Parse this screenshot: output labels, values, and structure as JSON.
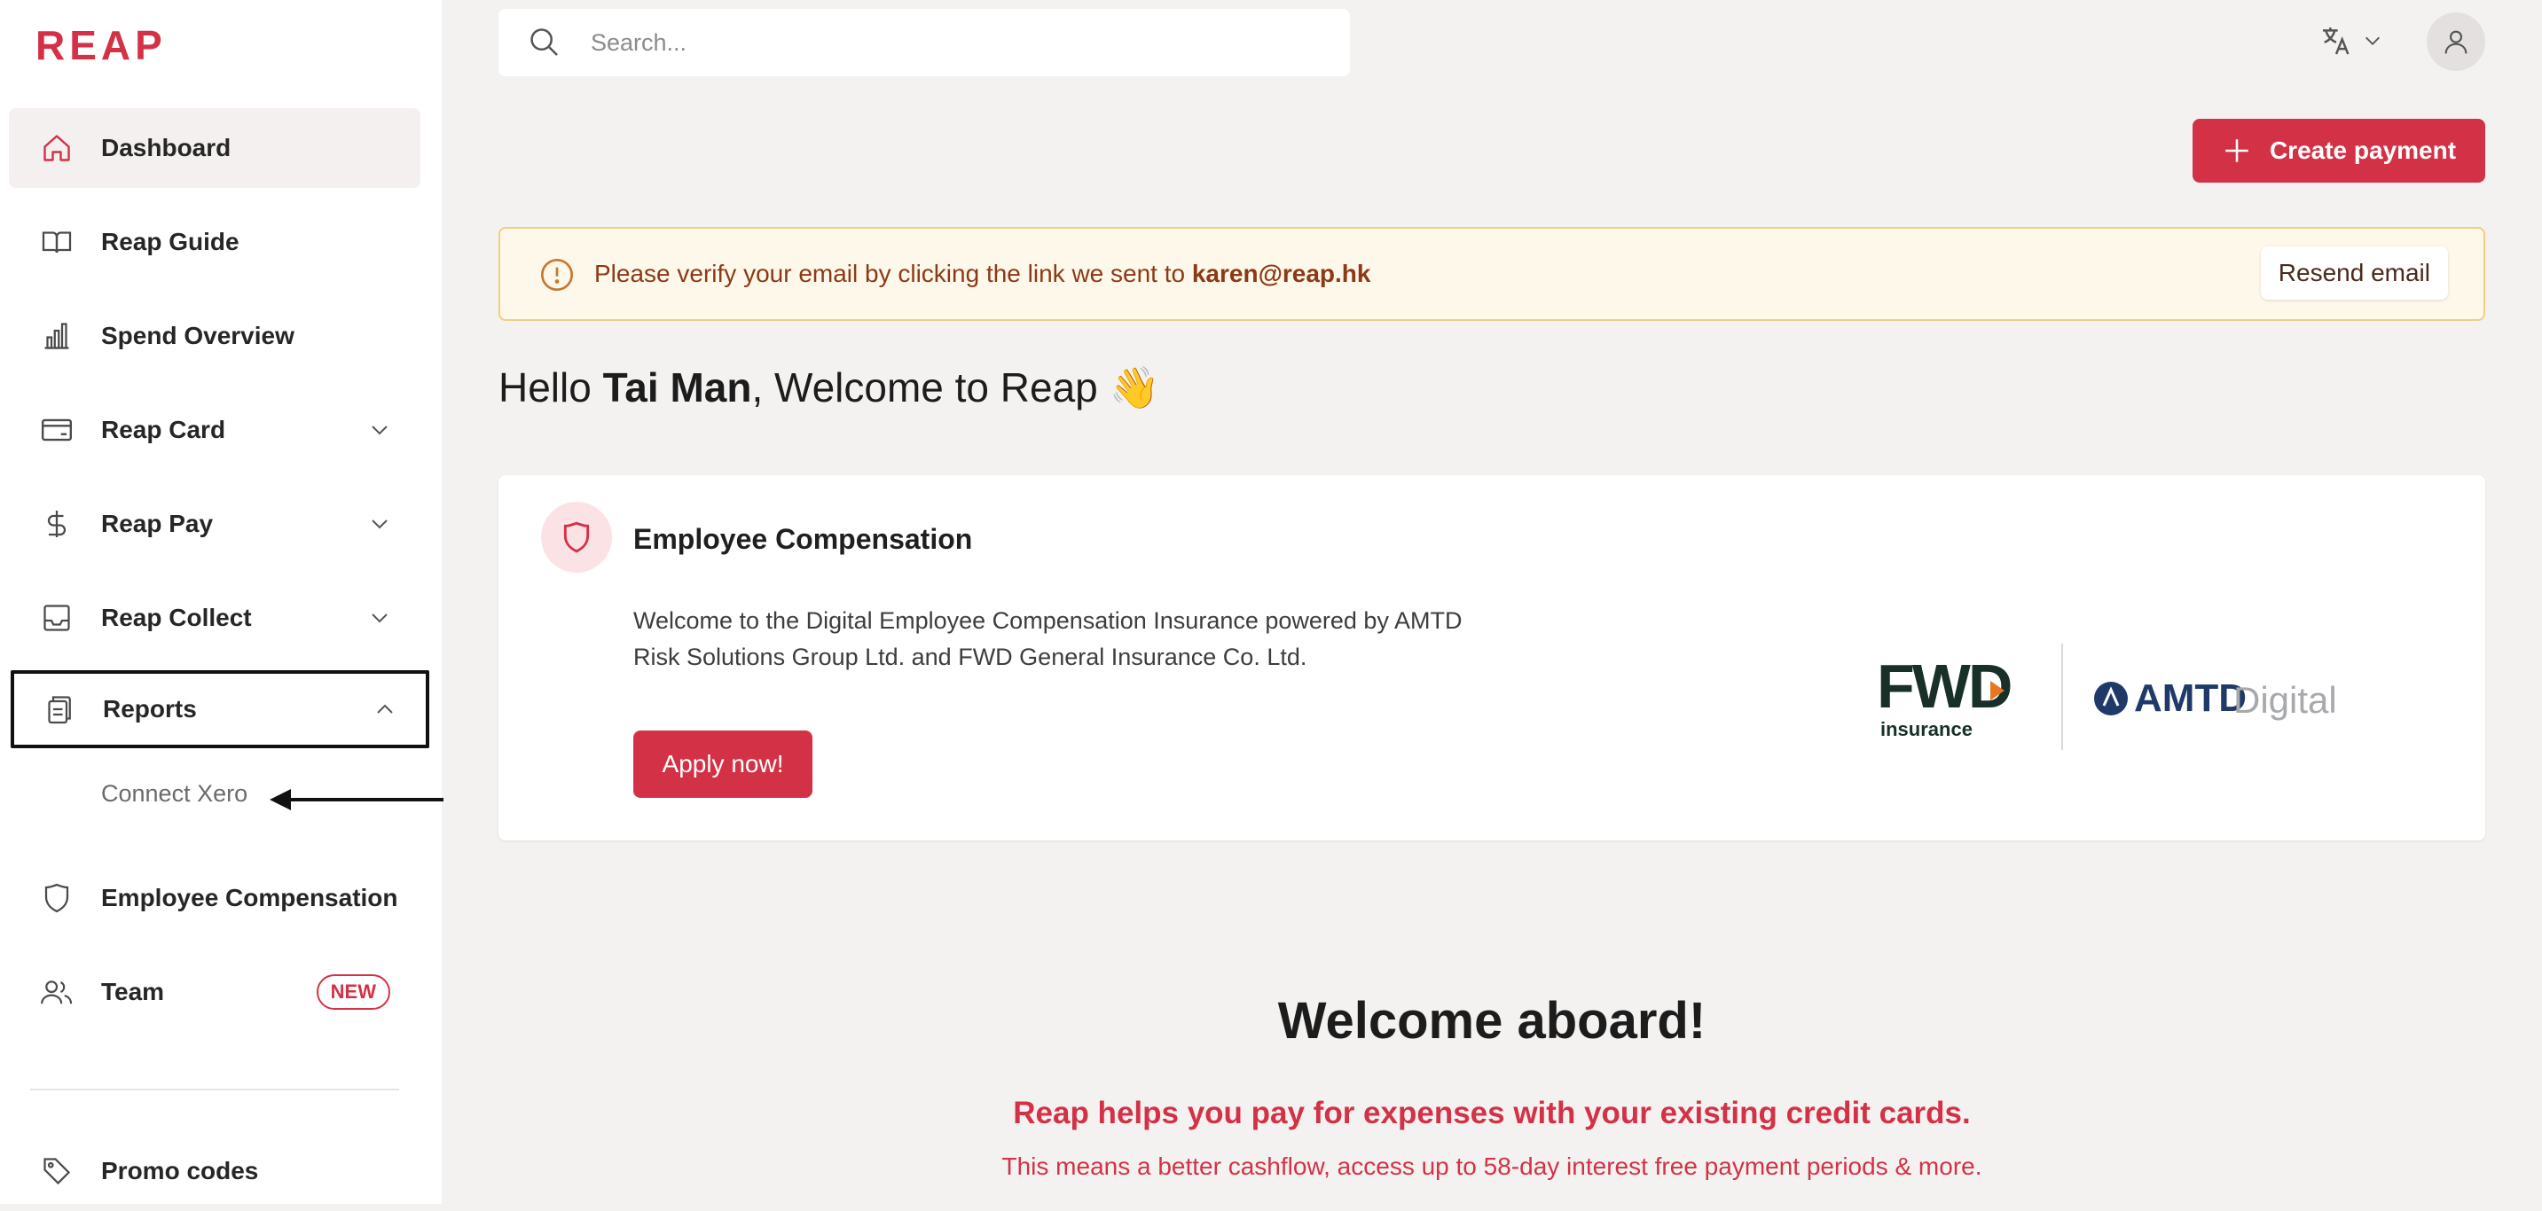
{
  "brand": {
    "logo_text": "REAP",
    "accent": "#d33246"
  },
  "sidebar": {
    "items": [
      {
        "label": "Dashboard",
        "icon": "home-icon",
        "active": true
      },
      {
        "label": "Reap Guide",
        "icon": "book-icon"
      },
      {
        "label": "Spend Overview",
        "icon": "bar-chart-icon"
      },
      {
        "label": "Reap Card",
        "icon": "card-icon",
        "expandable": true
      },
      {
        "label": "Reap Pay",
        "icon": "dollar-icon",
        "expandable": true
      },
      {
        "label": "Reap Collect",
        "icon": "inbox-icon",
        "expandable": true
      },
      {
        "label": "Reports",
        "icon": "documents-icon",
        "expanded": true
      },
      {
        "label": "Employee Compensation",
        "icon": "shield-icon"
      },
      {
        "label": "Team",
        "icon": "users-icon",
        "badge": "NEW"
      },
      {
        "label": "Promo codes",
        "icon": "tag-icon"
      }
    ],
    "reports_sub": {
      "label": "Connect Xero"
    }
  },
  "search": {
    "placeholder": "Search..."
  },
  "header": {
    "create_label": "Create payment"
  },
  "alert": {
    "text": "Please verify your email by clicking the link we sent to ",
    "email": "karen@reap.hk",
    "button": "Resend email"
  },
  "greeting": {
    "prefix": "Hello ",
    "name": "Tai Man",
    "suffix": ", Welcome to Reap 👋"
  },
  "card": {
    "title": "Employee Compensation",
    "description": "Welcome to the Digital Employee Compensation Insurance powered by AMTD Risk Solutions Group Ltd. and FWD General Insurance Co. Ltd.",
    "button": "Apply now!",
    "logo_fwd": "FWD",
    "logo_fwd_sub": "insurance",
    "logo_amtd": "AMTD",
    "logo_amtd_sub": "Digital"
  },
  "welcome": {
    "title": "Welcome aboard!",
    "tagline": "Reap helps you pay for expenses with your existing credit cards.",
    "subline": "This means a better cashflow, access up to 58-day interest free payment periods & more."
  }
}
